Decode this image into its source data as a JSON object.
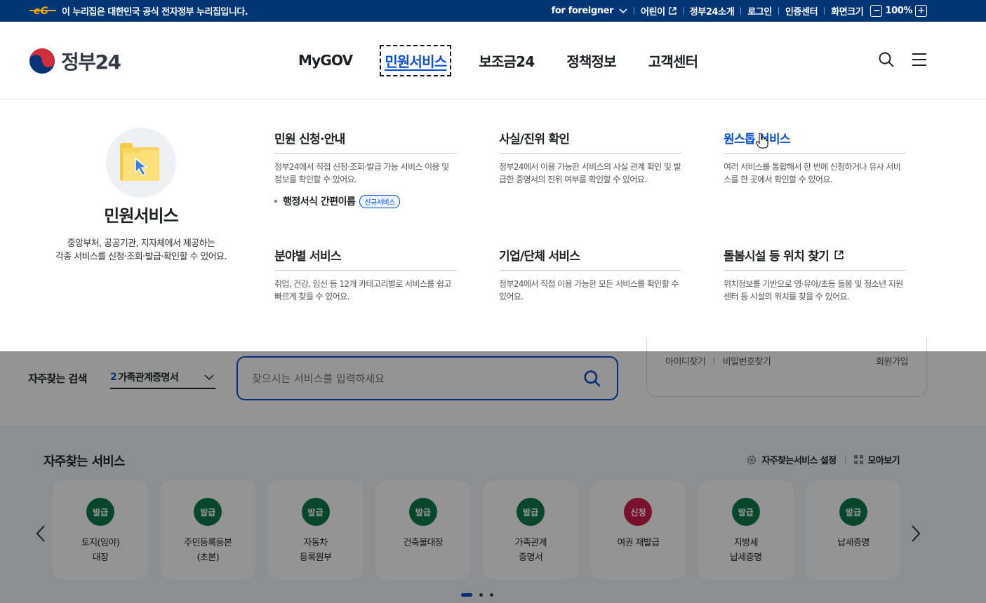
{
  "topbar": {
    "gov_notice": "이 누리집은 대한민국 공식 전자정부 누리집입니다.",
    "foreigner": "for foreigner",
    "kids": "어린이",
    "about": "정부24소개",
    "login": "로그인",
    "cert": "인증센터",
    "screen_size": "화면크기",
    "zoom_minus": "−",
    "zoom_level": "100%",
    "zoom_plus": "+"
  },
  "header": {
    "brand": "정부24",
    "nav": [
      {
        "label": "MyGOV"
      },
      {
        "label": "민원서비스"
      },
      {
        "label": "보조금24"
      },
      {
        "label": "정책정보"
      },
      {
        "label": "고객센터"
      }
    ]
  },
  "mega": {
    "title": "민원서비스",
    "desc_line1": "중앙부처, 공공기관, 지자체에서 제공하는",
    "desc_line2": "각종 서비스를 신청·조회·발급·확인할 수 있어요.",
    "columns": [
      {
        "title": "민원 신청·안내",
        "desc": "정부24에서 직접 신청·조회·발급 가능 서비스 이용 및 정보를 확인할 수 있어요.",
        "sub": "행정서식 간편이름",
        "badge": "신규서비스"
      },
      {
        "title": "사실/진위 확인",
        "desc": "정부24에서 이용 가능한 서비스의 사실 관계 확인 및 발급한 증명서의 진위 여부를 확인할 수 있어요."
      },
      {
        "title": "원스톱 서비스",
        "desc": "여러 서비스를 통합해서 한 번에 신청하거나 유사 서비스를 한 곳에서 확인할 수 있어요."
      },
      {
        "title": "분야별 서비스",
        "desc": "취업, 건강, 임신 등 12개 카테고리별로 서비스를 쉽고 빠르게 찾을 수 있어요."
      },
      {
        "title": "기업/단체 서비스",
        "desc": "정부24에서 직접 이용 가능한 모든 서비스를 확인할 수 있어요."
      },
      {
        "title": "돌봄시설 등 위치 찾기",
        "desc": "위치정보를 기반으로 영·유아/초등 돌봄 및 청소년 지원센터 등 시설의 위치를 찾을 수 있어요."
      }
    ]
  },
  "search": {
    "label": "자주찾는 검색",
    "keyword_num": "2",
    "keyword": "가족관계증명서",
    "placeholder": "찾으시는 서비스를 입력하세요"
  },
  "login_card": {
    "find_id": "아이디찾기",
    "find_pw": "비밀번호찾기",
    "join": "회원가입"
  },
  "freq": {
    "title": "자주찾는 서비스",
    "setting": "자주찾는서비스 설정",
    "viewall": "모아보기",
    "cards": [
      {
        "badge": "발급",
        "label": "토지(임야)\n대장"
      },
      {
        "badge": "발급",
        "label": "주민등록등본\n(초본)"
      },
      {
        "badge": "발급",
        "label": "자동차\n등록원부"
      },
      {
        "badge": "발급",
        "label": "건축물대장"
      },
      {
        "badge": "발급",
        "label": "가족관계\n증명서"
      },
      {
        "badge": "신청",
        "label": "여권 재발급"
      },
      {
        "badge": "발급",
        "label": "지방세\n납세증명"
      },
      {
        "badge": "발급",
        "label": "납세증명"
      }
    ]
  },
  "colors": {
    "primary": "#003675",
    "accent": "#0b50d0",
    "issue": "#0f7a4b",
    "apply": "#d11e4f"
  }
}
